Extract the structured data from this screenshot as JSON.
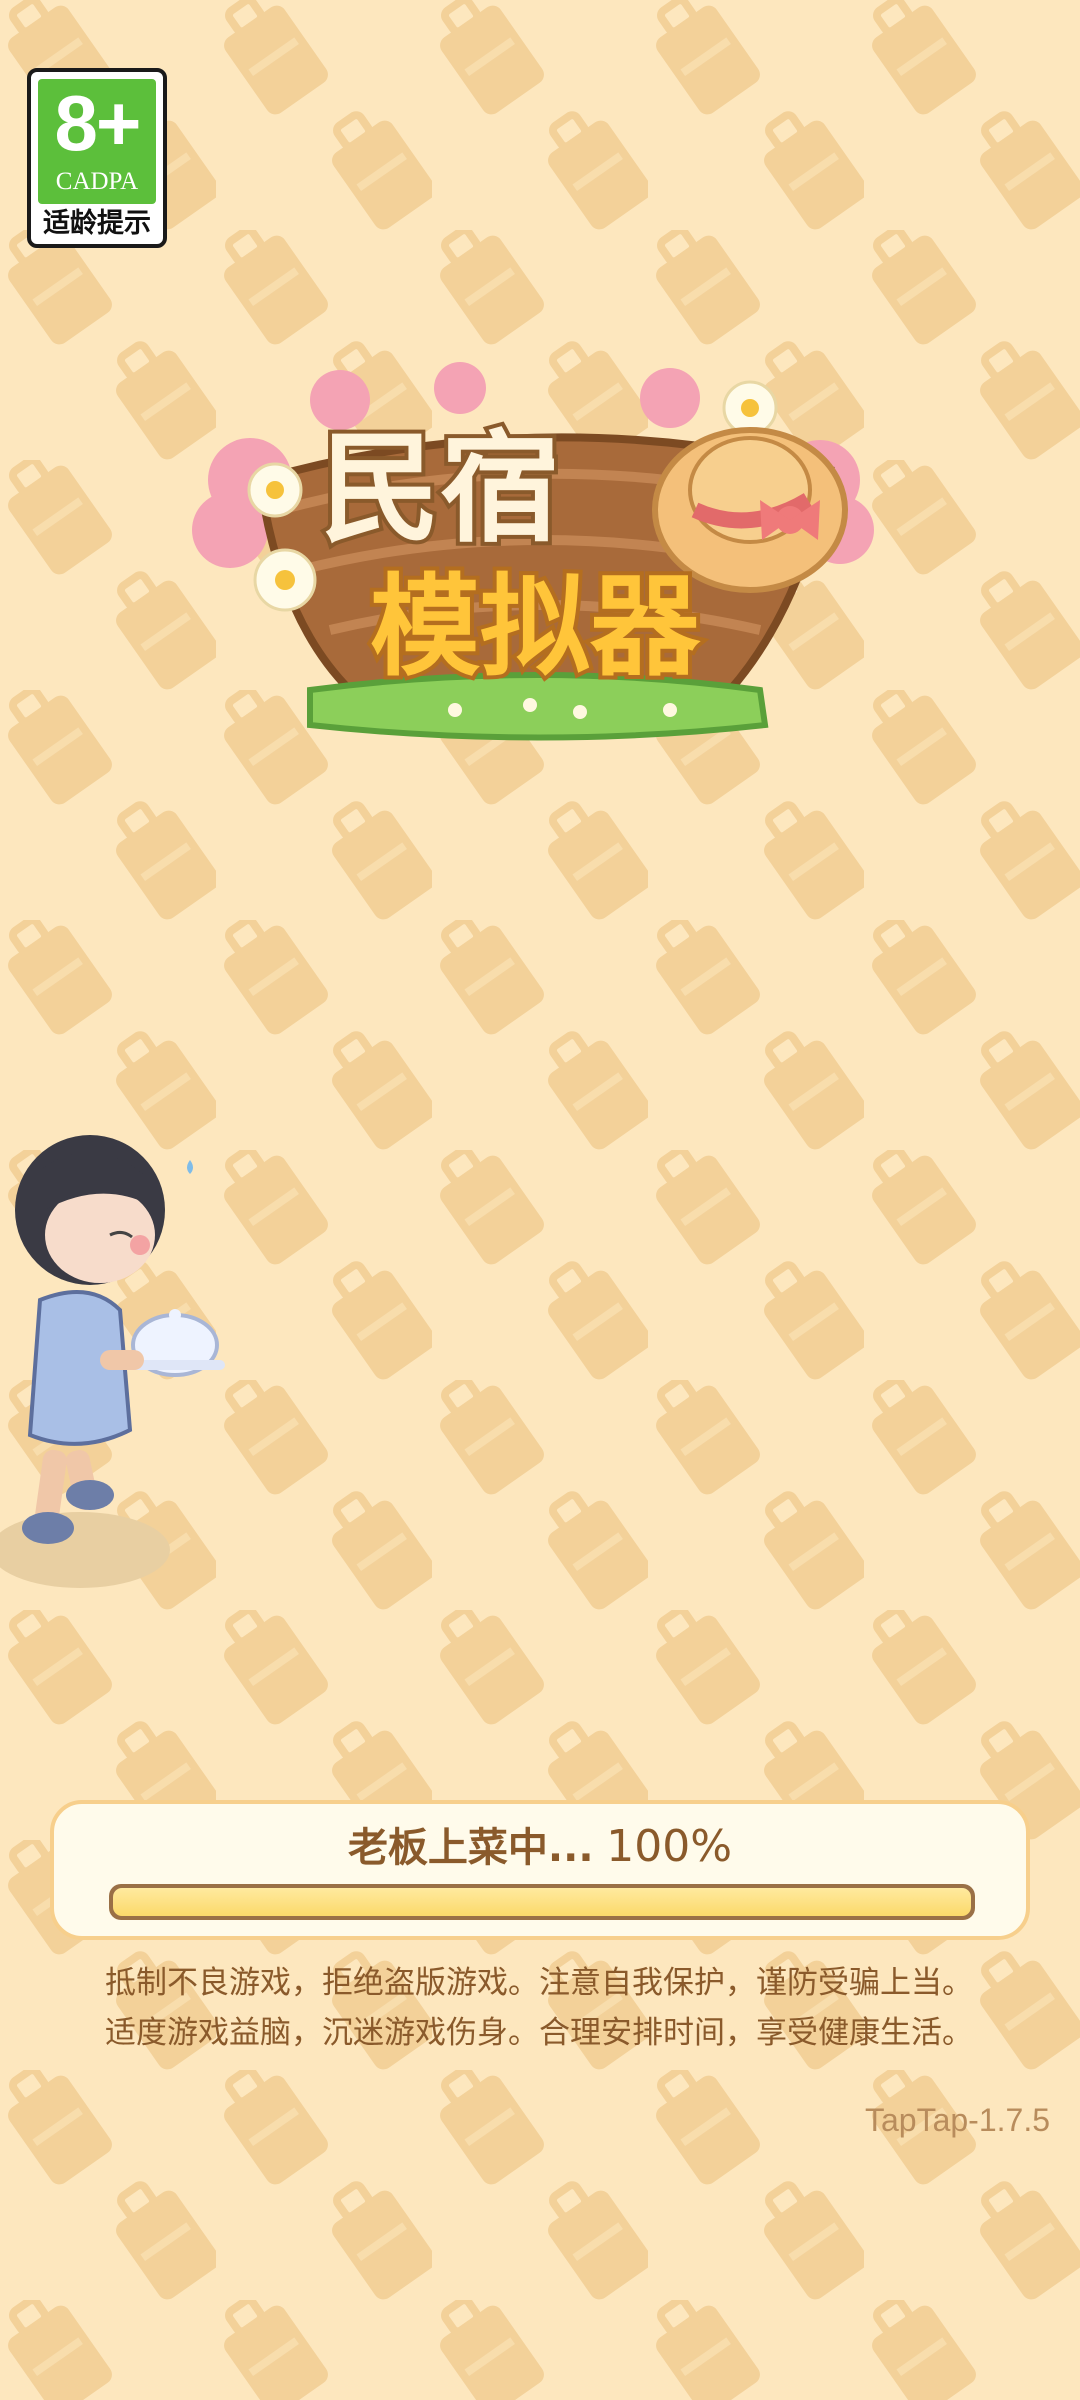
{
  "age_rating": {
    "age": "8+",
    "org": "CADPA",
    "tip": "适龄提示"
  },
  "logo": {
    "line1": "民宿",
    "line2": "模拟器"
  },
  "loading": {
    "label": "老板上菜中...",
    "percent_text": "100%",
    "progress": 1.0
  },
  "notice": {
    "line1": "抵制不良游戏，拒绝盗版游戏。注意自我保护，谨防受骗上当。",
    "line2": "适度游戏益脑，沉迷游戏伤身。合理安排时间，享受健康生活。"
  },
  "version": "TapTap-1.7.5",
  "colors": {
    "background": "#fde7be",
    "pattern": "#efc98d",
    "text_brown": "#8a5a2b",
    "badge_green": "#5cbf3b",
    "progress_fill": "#fbd96a"
  }
}
